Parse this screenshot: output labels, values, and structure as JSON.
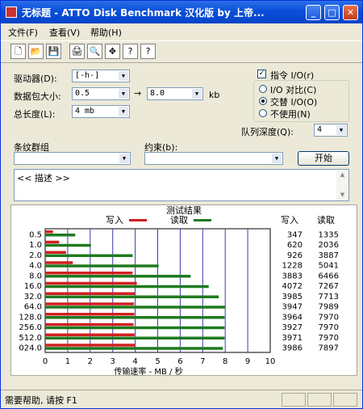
{
  "window": {
    "title": "无标题 - ATTO Disk Benchmark 汉化版 by 上帝...",
    "minimize": "_",
    "maximize": "□",
    "close": "✕"
  },
  "menu": [
    "文件(F)",
    "查看(V)",
    "帮助(H)"
  ],
  "toolbar": {
    "icons": [
      "new-file-icon",
      "open-folder-icon",
      "save-icon",
      "print-icon",
      "print-preview-icon",
      "move-icon",
      "help-icon",
      "context-help-icon"
    ],
    "glyphs": [
      "🗋",
      "📂",
      "💾",
      "🖨",
      "🔍",
      "✥",
      "?",
      "?"
    ]
  },
  "settings": {
    "drive_label": "驱动器(D):",
    "drive_value": "[-h-]",
    "transfer_label": "数据包大小:",
    "transfer_from": "0.5",
    "transfer_to": "8.0",
    "transfer_arrow": "→",
    "transfer_unit": "kb",
    "total_label": "总长度(L):",
    "total_value": "4 mb",
    "direct_io_label": "指令 I/O(r)",
    "direct_io_checked": "✓",
    "io_options": [
      "I/O 对比(C)",
      "交替 I/O(O)",
      "不使用(N)"
    ],
    "io_selected": "交替 I/O(O)",
    "queue_label": "队列深度(Q):",
    "queue_value": "4",
    "stripe_label": "条纹群组",
    "restrict_label": "约束(b):",
    "start_button": "开始",
    "description": "<< 描述 >>"
  },
  "results": {
    "title": "测试结果",
    "write_label": "写入",
    "read_label": "读取",
    "col_write": "写入",
    "col_read": "读取",
    "xlabel": "传输速率 - MB / 秒",
    "write_color": "#d02020",
    "read_color": "#1f7a1f"
  },
  "chart_data": {
    "type": "bar",
    "orientation": "horizontal",
    "categories": [
      "0.5",
      "1.0",
      "2.0",
      "4.0",
      "8.0",
      "16.0",
      "32.0",
      "64.0",
      "128.0",
      "256.0",
      "512.0",
      "024.0"
    ],
    "series": [
      {
        "name": "写入",
        "values": [
          347,
          620,
          926,
          1228,
          3883,
          4072,
          3985,
          3947,
          3964,
          3927,
          3971,
          3986
        ]
      },
      {
        "name": "读取",
        "values": [
          1335,
          2036,
          3887,
          5041,
          6466,
          7267,
          7713,
          7989,
          7970,
          7970,
          7970,
          7897
        ]
      }
    ],
    "xticks": [
      "0",
      "1",
      "2",
      "3",
      "4",
      "5",
      "6",
      "7",
      "8",
      "9",
      "10"
    ],
    "xlim": [
      0,
      10
    ],
    "xlabel": "传输速率 - MB / 秒",
    "grid": true,
    "legend": "top"
  },
  "status": {
    "text": "需要帮助, 请按 F1"
  }
}
